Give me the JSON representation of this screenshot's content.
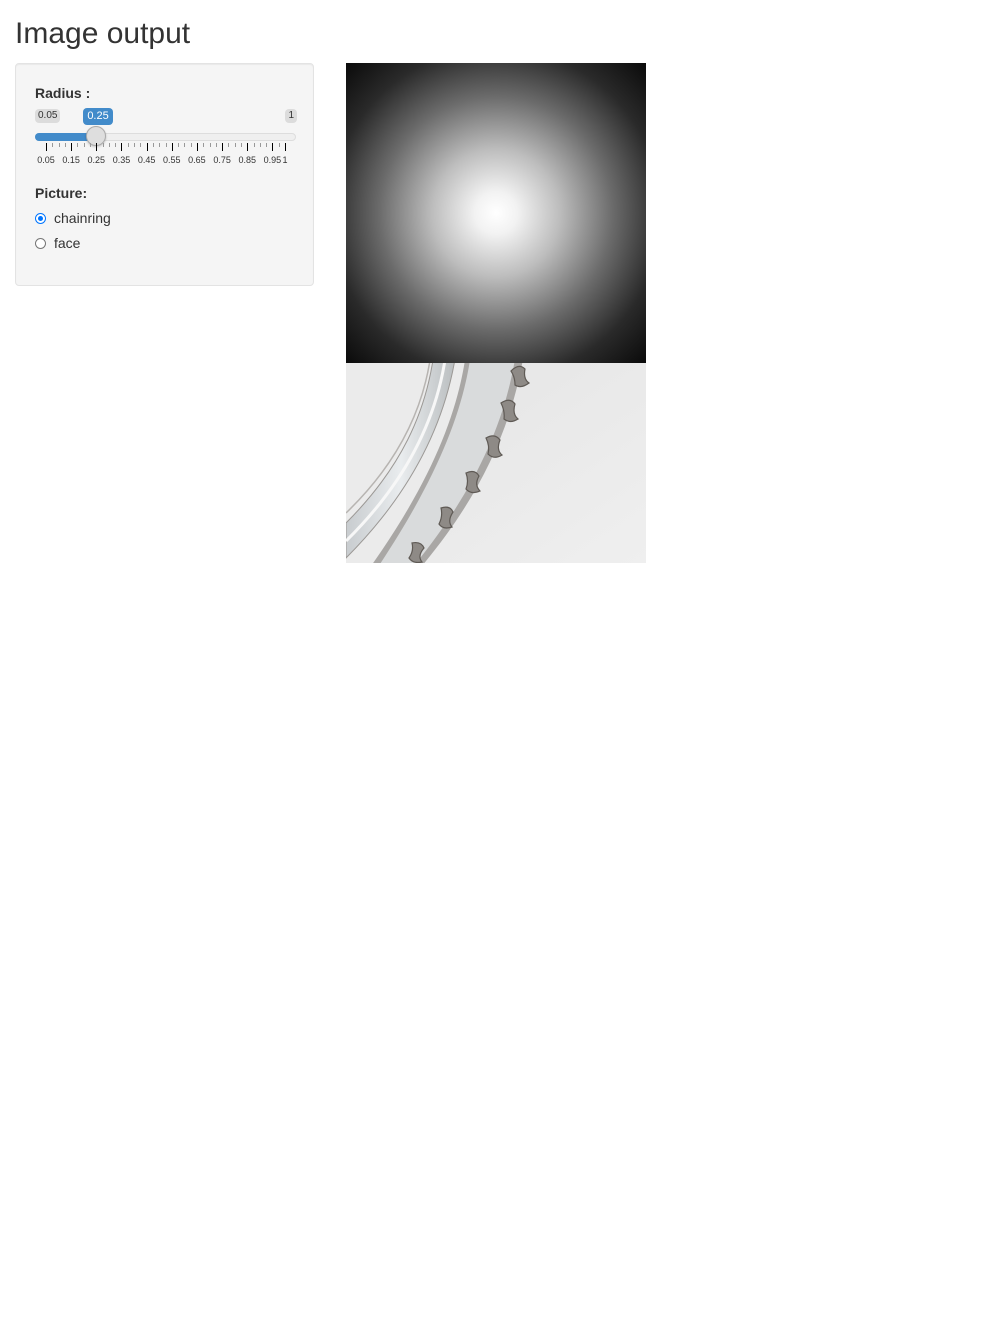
{
  "page": {
    "title": "Image output"
  },
  "sidebar": {
    "radius": {
      "label": "Radius :",
      "min": "0.05",
      "max": "1",
      "value": "0.25",
      "value_number": 0.25,
      "min_number": 0.05,
      "max_number": 1,
      "ticks": [
        "0.05",
        "0.15",
        "0.25",
        "0.35",
        "0.45",
        "0.55",
        "0.65",
        "0.75",
        "0.85",
        "0.95",
        "1"
      ]
    },
    "picture": {
      "label": "Picture:",
      "options": [
        {
          "label": "chainring",
          "checked": true
        },
        {
          "label": "face",
          "checked": false
        }
      ]
    }
  },
  "outputs": {
    "generated_image_icon": "radial-gradient-image",
    "photo_icon": "chainring-photo"
  },
  "colors": {
    "accent": "#428bca",
    "radio_accent": "#0075ff",
    "panel_bg": "#f5f5f5"
  }
}
